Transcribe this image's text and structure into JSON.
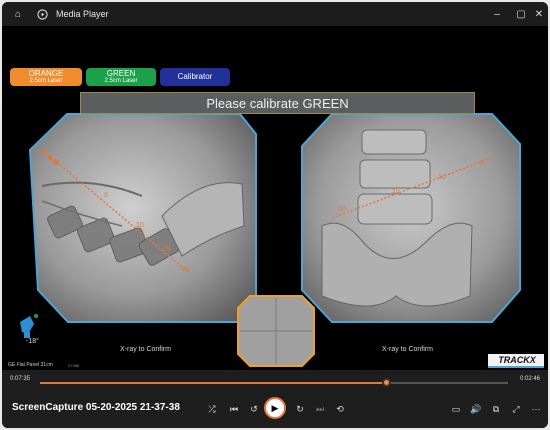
{
  "window": {
    "title": "Media Player",
    "icons": {
      "home": "home-icon",
      "app": "play-circle-icon"
    },
    "controls": {
      "minimize": "minimize-icon",
      "maximize": "maximize-icon",
      "close": "close-icon"
    }
  },
  "overlay": {
    "laser_buttons": [
      {
        "name": "ORANGE",
        "sub": "2.5cm Laser",
        "color": "#f08c2c"
      },
      {
        "name": "GREEN",
        "sub": "2.5cm Laser",
        "color": "#1aa14a"
      },
      {
        "name": "Calibrator",
        "sub": "",
        "color": "#22309a"
      }
    ],
    "banner": "Please calibrate GREEN",
    "left_xray": {
      "laser_markers": [
        "5",
        "10",
        "15",
        "20"
      ],
      "confirm": "X-ray to Confirm"
    },
    "right_xray": {
      "laser_markers": [
        "20",
        "15",
        "10",
        "5"
      ],
      "confirm": "X-ray to Confirm"
    },
    "angle": "-18°",
    "panel": "GE Flat Panel 31cm",
    "panel_code": "27388",
    "brand": "TRACKX"
  },
  "colors": {
    "accent": "#e2773c",
    "frame": "#4aa6d6",
    "center_frame": "#f0a020",
    "laser": "#e2773c"
  },
  "player": {
    "time_elapsed": "0:07:35",
    "time_remaining": "0:02:46",
    "progress": 0.74,
    "title": "ScreenCapture 05-20-2025 21-37-38",
    "buttons": {
      "shuffle": "shuffle-icon",
      "previous": "previous-icon",
      "rewind": "rewind-10-icon",
      "play": "play-icon",
      "forward": "forward-30-icon",
      "next": "next-icon",
      "repeat": "repeat-icon",
      "captions": "captions-icon",
      "volume": "volume-icon",
      "cast": "cast-icon",
      "fullscreen": "fullscreen-icon",
      "more": "more-icon"
    }
  }
}
